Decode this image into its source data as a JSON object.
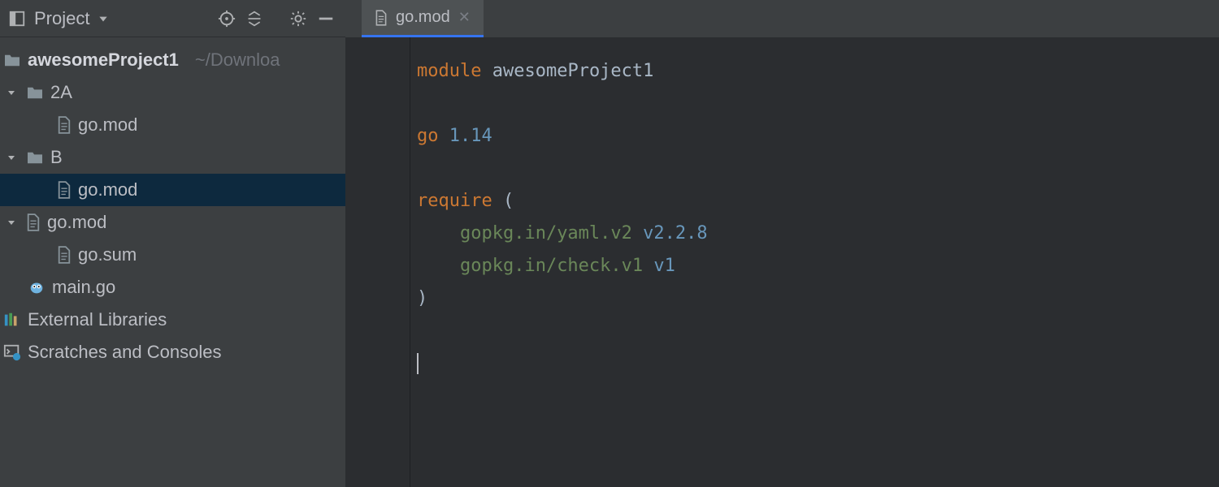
{
  "sidebar": {
    "title": "Project",
    "root": {
      "name": "awesomeProject1",
      "hint": "~/Downloa"
    },
    "tree": {
      "folder2A": "2A",
      "folder2A_gomod": "go.mod",
      "folderB": "B",
      "folderB_gomod": "go.mod",
      "root_gomod": "go.mod",
      "gosum": "go.sum",
      "maingo": "main.go",
      "external": "External Libraries",
      "scratches": "Scratches and Consoles"
    }
  },
  "tabs": {
    "active": "go.mod"
  },
  "code": {
    "l1_kw": "module",
    "l1_ident": "awesomeProject1",
    "l3_kw": "go",
    "l3_num": "1.14",
    "l5_kw": "require",
    "l5_paren_open": "(",
    "l6_pkg": "gopkg.in/yaml.v2",
    "l6_ver": "v2.2.8",
    "l7_pkg": "gopkg.in/check.v1",
    "l7_ver": "v1",
    "l8_paren_close": ")"
  }
}
